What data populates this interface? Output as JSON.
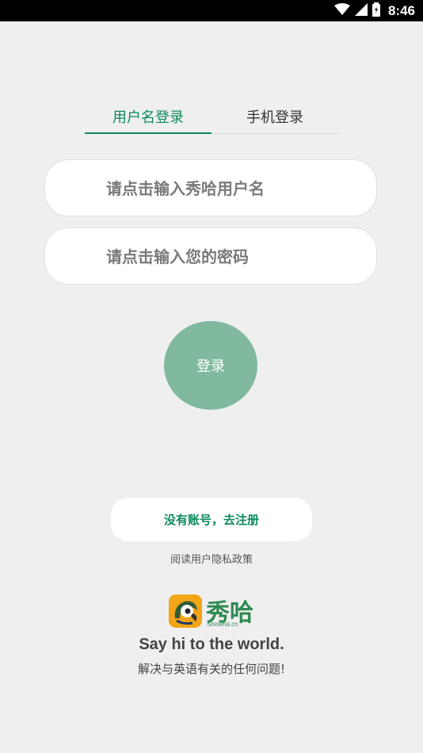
{
  "status_bar": {
    "time": "8:46"
  },
  "tabs": [
    {
      "label": "用户名登录",
      "active": true
    },
    {
      "label": "手机登录",
      "active": false
    }
  ],
  "form": {
    "username_placeholder": "请点击输入秀哈用户名",
    "password_placeholder": "请点击输入您的密码",
    "login_label": "登录"
  },
  "register_label": "没有账号，去注册",
  "privacy_label": "阅读用户隐私政策",
  "brand": {
    "name": "秀哈",
    "domain": "Showha.cn",
    "slogan": "Say hi to the world.",
    "tagline": "解决与英语有关的任何问题!"
  },
  "colors": {
    "accent": "#0e8a5b",
    "button": "#80b99d",
    "background": "#efefef"
  }
}
